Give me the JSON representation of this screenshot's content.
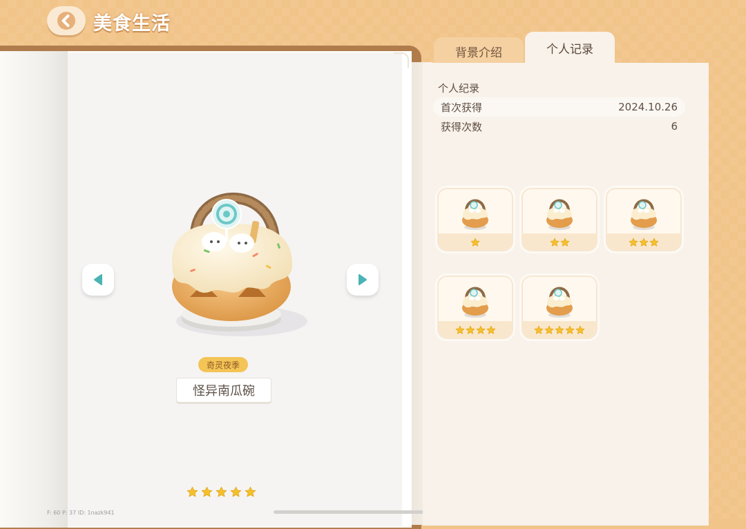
{
  "header": {
    "title": "美食生活",
    "back_label": ""
  },
  "tabs": [
    {
      "label": "背景介绍",
      "active": false
    },
    {
      "label": "个人记录",
      "active": true
    }
  ],
  "item": {
    "season_tag": "奇灵夜季",
    "name": "怪异南瓜碗",
    "stars": 5
  },
  "record": {
    "section_title": "个人纪录",
    "rows": [
      {
        "label": "首次获得",
        "value": "2024.10.26"
      },
      {
        "label": "获得次数",
        "value": "6"
      }
    ]
  },
  "variants": [
    {
      "stars": 1
    },
    {
      "stars": 2
    },
    {
      "stars": 3
    },
    {
      "stars": 4
    },
    {
      "stars": 5
    }
  ],
  "debug": {
    "text": "F: 60    P: 37    ID: 1nazk941"
  },
  "colors": {
    "background": "#f1c48a",
    "star": "#f5c02c",
    "accent_teal": "#4bb3b5",
    "panel": "#f8f2ea"
  },
  "icons": {
    "back": "chevron-left-icon",
    "prev": "triangle-left-icon",
    "next": "triangle-right-icon",
    "star": "star-icon",
    "item": "pumpkin-bowl-icon"
  }
}
